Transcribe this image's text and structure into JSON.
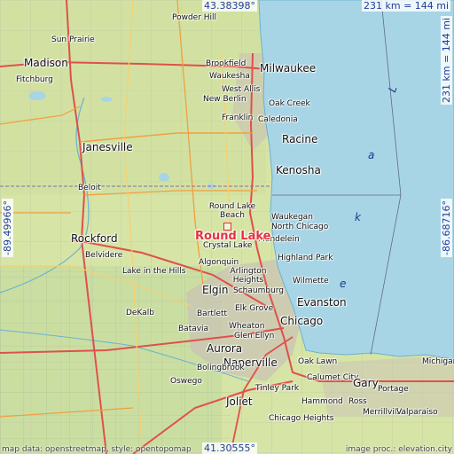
{
  "map": {
    "highlight": "Round Lake",
    "lake_letters": [
      "L",
      "a",
      "k",
      "e"
    ],
    "coords": {
      "top": "43.38398°",
      "bottom": "41.30555°",
      "left": "-89.49966°",
      "right": "-86.68716°"
    },
    "scale": {
      "horizontal": "231 km = 144 mi",
      "vertical": "231 km = 144 mi"
    },
    "footer": {
      "left": "map data: openstreetmap, style: opentopomap",
      "right": "image proc.: elevation.city"
    },
    "places": [
      "Powder Hill",
      "Sun Prairie",
      "Madison",
      "Fitchburg",
      "Brookfield",
      "Milwaukee",
      "Waukesha",
      "West Allis",
      "New Berlin",
      "Oak Creek",
      "Franklin",
      "Caledonia",
      "Racine",
      "Janesville",
      "Kenosha",
      "Beloit",
      "Round Lake Beach",
      "Waukegan",
      "North Chicago",
      "Rockford",
      "Mundelein",
      "Crystal Lake",
      "Belvidere",
      "Highland Park",
      "Algonquin",
      "Arlington Heights",
      "Lake in the Hills",
      "Wilmette",
      "Elgin",
      "Schaumburg",
      "Evanston",
      "DeKalb",
      "Bartlett",
      "Elk Grove",
      "Chicago",
      "Batavia",
      "Wheaton",
      "Glen Ellyn",
      "Aurora",
      "Naperville",
      "Oak Lawn",
      "Michigan City",
      "Bolingbrook",
      "Calumet City",
      "Gary",
      "Portage",
      "Oswego",
      "Tinley Park",
      "Hammond",
      "Ross",
      "Merrillville",
      "Valparaiso",
      "Joliet",
      "Chicago Heights"
    ]
  }
}
